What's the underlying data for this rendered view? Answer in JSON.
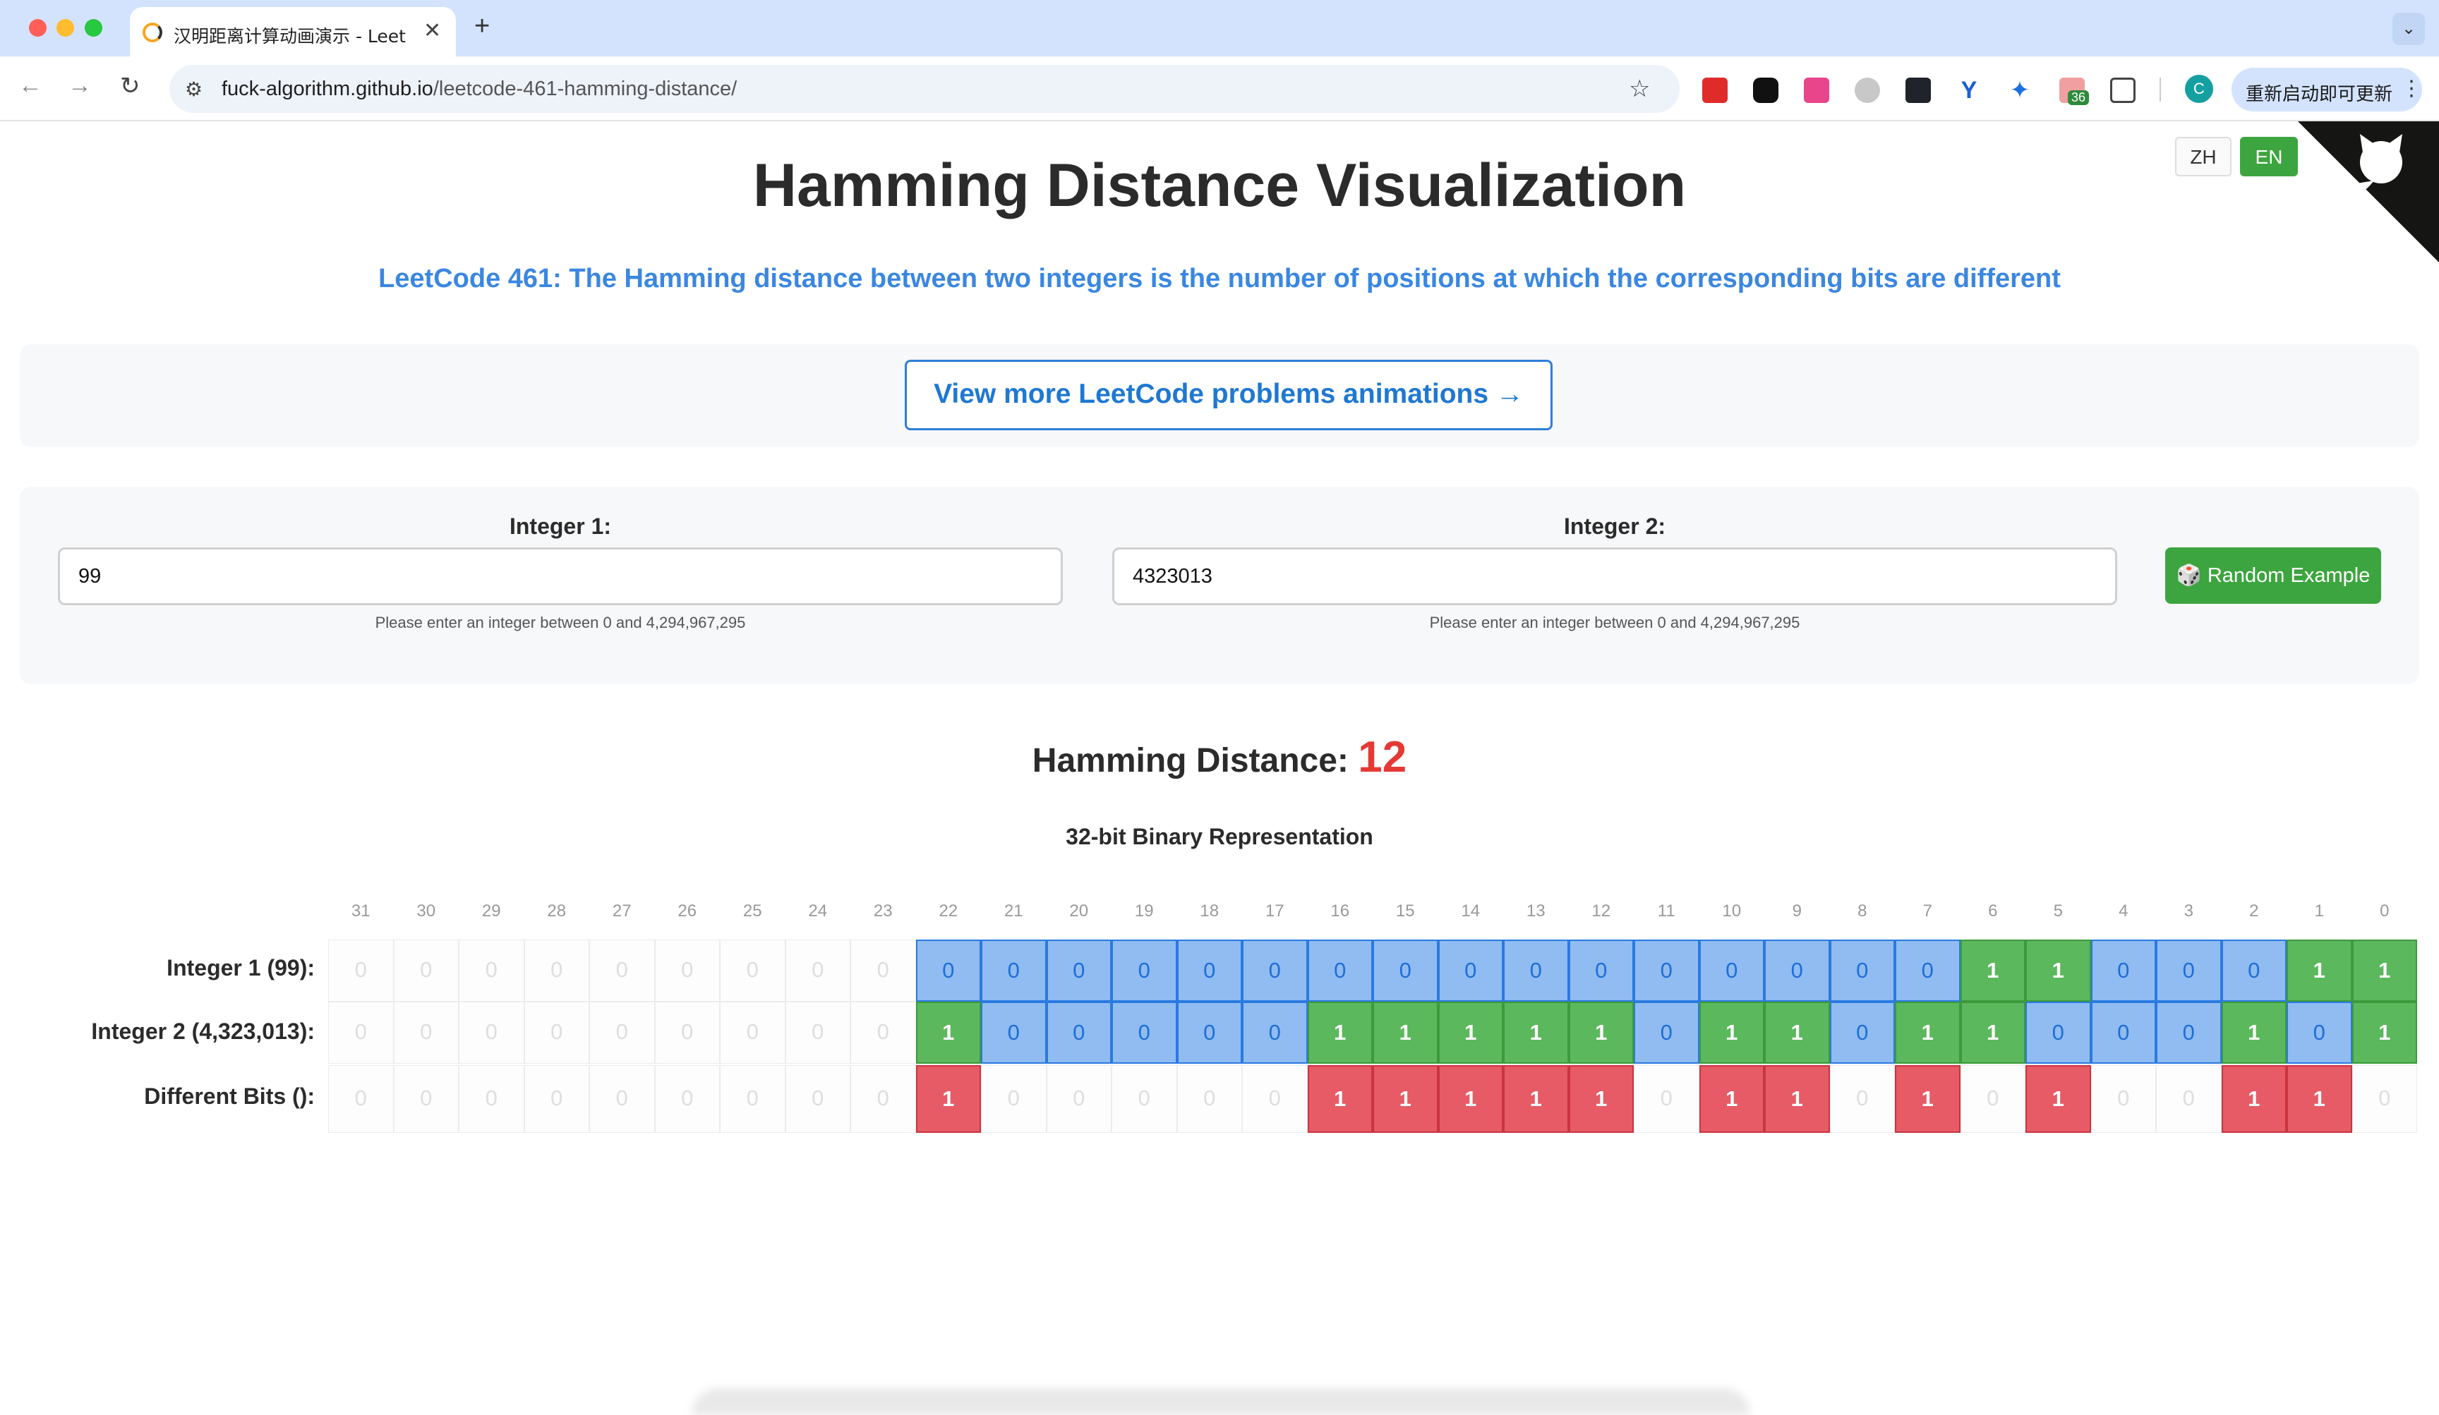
{
  "browser": {
    "tab_title": "汉明距离计算动画演示 - LeetCode",
    "tab_close": "✕",
    "new_tab": "+",
    "tab_menu": "⌄",
    "url_host": "fuck-algorithm.github.io",
    "url_path": "/leetcode-461-hamming-distance/",
    "extension_badge": "36",
    "profile_initial": "C",
    "update_label": "重新启动即可更新",
    "icons": [
      "back-icon",
      "forward-icon",
      "reload-icon",
      "site-info-icon",
      "bookmark-star-icon",
      "extensions-icon",
      "menu-dots-icon"
    ]
  },
  "page": {
    "lang_zh": "ZH",
    "lang_en": "EN",
    "title": "Hamming Distance Visualization",
    "subtitle": "LeetCode 461: The Hamming distance between two integers is the number of positions at which the corresponding bits are different",
    "more_link": "View more LeetCode problems animations →",
    "integer1_label": "Integer 1:",
    "integer1_value": "99",
    "integer2_label": "Integer 2:",
    "integer2_value": "4323013",
    "input_hint": "Please enter an integer between 0 and 4,294,967,295",
    "random_button": "🎲 Random Example",
    "hd_label": "Hamming Distance:",
    "hd_value": "12",
    "binary_heading": "32-bit Binary Representation",
    "row_labels": [
      "Integer 1 (99):",
      "Integer 2 (4,323,013):",
      "Different Bits ():"
    ],
    "bit_indices": [
      31,
      30,
      29,
      28,
      27,
      26,
      25,
      24,
      23,
      22,
      21,
      20,
      19,
      18,
      17,
      16,
      15,
      14,
      13,
      12,
      11,
      10,
      9,
      8,
      7,
      6,
      5,
      4,
      3,
      2,
      1,
      0
    ],
    "int1_bits": [
      0,
      0,
      0,
      0,
      0,
      0,
      0,
      0,
      0,
      0,
      0,
      0,
      0,
      0,
      0,
      0,
      0,
      0,
      0,
      0,
      0,
      0,
      0,
      0,
      0,
      1,
      1,
      0,
      0,
      0,
      1,
      1
    ],
    "int2_bits": [
      0,
      0,
      0,
      0,
      0,
      0,
      0,
      0,
      0,
      1,
      0,
      0,
      0,
      0,
      0,
      1,
      1,
      1,
      1,
      1,
      0,
      1,
      1,
      0,
      1,
      1,
      0,
      0,
      0,
      1,
      0,
      1
    ],
    "diff_bits": [
      0,
      0,
      0,
      0,
      0,
      0,
      0,
      0,
      0,
      1,
      0,
      0,
      0,
      0,
      0,
      1,
      1,
      1,
      1,
      1,
      0,
      1,
      1,
      0,
      1,
      0,
      1,
      0,
      0,
      1,
      1,
      0
    ],
    "int1_active_from": 9,
    "int2_active_from": 9,
    "colors": {
      "one_green": "#5cb85c",
      "zero_blue": "#90bcf2",
      "diff_red": "#e65b66",
      "accent_blue": "#3b87e0",
      "hd_red": "#e53935",
      "button_green": "#3da53f"
    }
  }
}
